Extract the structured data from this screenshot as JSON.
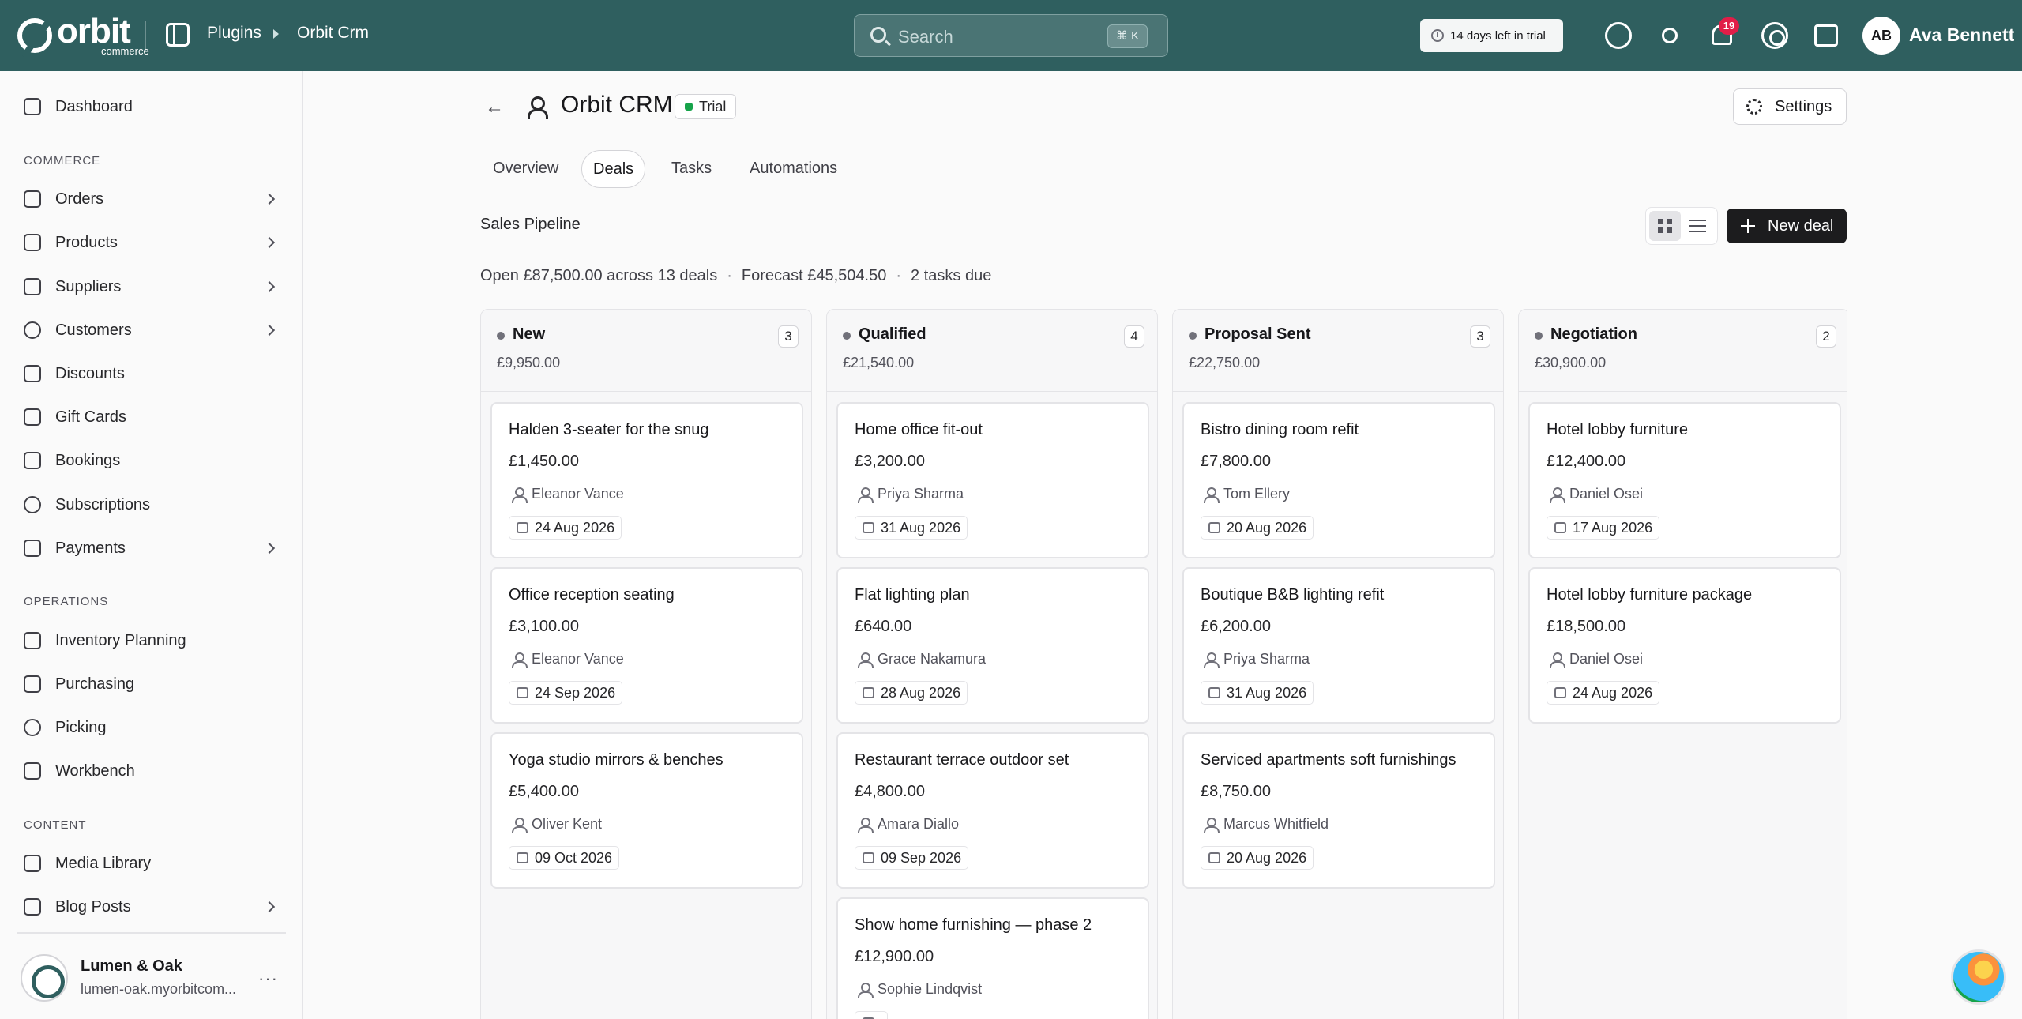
{
  "topbar": {
    "brand_name": "orbit",
    "brand_sub": "commerce",
    "breadcrumbs": [
      "Plugins",
      "Orbit Crm"
    ],
    "search_placeholder": "Search",
    "search_shortcut": "⌘ K",
    "trial_notice": "14 days left in trial",
    "notification_count": "19",
    "user_initials": "AB",
    "user_name": "Ava Bennett"
  },
  "sidebar": {
    "top_items": [
      {
        "label": "Dashboard",
        "icon": "dashboard-icon"
      }
    ],
    "sections": [
      {
        "title": "COMMERCE",
        "items": [
          {
            "label": "Orders",
            "icon": "orders-icon",
            "expandable": true
          },
          {
            "label": "Products",
            "icon": "products-icon",
            "expandable": true
          },
          {
            "label": "Suppliers",
            "icon": "suppliers-icon",
            "expandable": true
          },
          {
            "label": "Customers",
            "icon": "customers-icon",
            "expandable": true
          },
          {
            "label": "Discounts",
            "icon": "tag-icon",
            "expandable": false
          },
          {
            "label": "Gift Cards",
            "icon": "gift-icon",
            "expandable": false
          },
          {
            "label": "Bookings",
            "icon": "calendar-icon",
            "expandable": false
          },
          {
            "label": "Subscriptions",
            "icon": "refresh-icon",
            "expandable": false
          },
          {
            "label": "Payments",
            "icon": "card-icon",
            "expandable": true
          }
        ]
      },
      {
        "title": "OPERATIONS",
        "items": [
          {
            "label": "Inventory Planning",
            "icon": "clipboard-icon",
            "expandable": false
          },
          {
            "label": "Purchasing",
            "icon": "box-icon",
            "expandable": false
          },
          {
            "label": "Picking",
            "icon": "pin-icon",
            "expandable": false
          },
          {
            "label": "Workbench",
            "icon": "cube-icon",
            "expandable": false
          }
        ]
      },
      {
        "title": "CONTENT",
        "items": [
          {
            "label": "Media Library",
            "icon": "image-icon",
            "expandable": false
          },
          {
            "label": "Blog Posts",
            "icon": "blog-icon",
            "expandable": true
          }
        ]
      }
    ],
    "store": {
      "name": "Lumen & Oak",
      "url": "lumen-oak.myorbitcom...",
      "more": "···"
    }
  },
  "page": {
    "title": "Orbit CRM",
    "badge": "Trial",
    "settings_label": "Settings",
    "tabs": [
      "Overview",
      "Deals",
      "Tasks",
      "Automations"
    ],
    "active_tab": "Deals",
    "section_title": "Sales Pipeline",
    "new_deal_label": "New deal",
    "summary": {
      "open": "Open £87,500.00 across 13 deals",
      "forecast": "Forecast £45,504.50",
      "tasks": "2 tasks due",
      "separator": "·"
    }
  },
  "columns": [
    {
      "name": "New",
      "total": "£9,950.00",
      "count": "3",
      "deals": [
        {
          "title": "Halden 3-seater for the snug",
          "amount": "£1,450.00",
          "owner": "Eleanor Vance",
          "date": "24 Aug 2026"
        },
        {
          "title": "Office reception seating",
          "amount": "£3,100.00",
          "owner": "Eleanor Vance",
          "date": "24 Sep 2026"
        },
        {
          "title": "Yoga studio mirrors & benches",
          "amount": "£5,400.00",
          "owner": "Oliver Kent",
          "date": "09 Oct 2026"
        }
      ]
    },
    {
      "name": "Qualified",
      "total": "£21,540.00",
      "count": "4",
      "deals": [
        {
          "title": "Home office fit-out",
          "amount": "£3,200.00",
          "owner": "Priya Sharma",
          "date": "31 Aug 2026"
        },
        {
          "title": "Flat lighting plan",
          "amount": "£640.00",
          "owner": "Grace Nakamura",
          "date": "28 Aug 2026"
        },
        {
          "title": "Restaurant terrace outdoor set",
          "amount": "£4,800.00",
          "owner": "Amara Diallo",
          "date": "09 Sep 2026"
        },
        {
          "title": "Show home furnishing — phase 2",
          "amount": "£12,900.00",
          "owner": "Sophie Lindqvist",
          "date": ""
        }
      ]
    },
    {
      "name": "Proposal Sent",
      "total": "£22,750.00",
      "count": "3",
      "deals": [
        {
          "title": "Bistro dining room refit",
          "amount": "£7,800.00",
          "owner": "Tom Ellery",
          "date": "20 Aug 2026"
        },
        {
          "title": "Boutique B&B lighting refit",
          "amount": "£6,200.00",
          "owner": "Priya Sharma",
          "date": "31 Aug 2026"
        },
        {
          "title": "Serviced apartments soft furnishings",
          "amount": "£8,750.00",
          "owner": "Marcus Whitfield",
          "date": "20 Aug 2026"
        }
      ]
    },
    {
      "name": "Negotiation",
      "total": "£30,900.00",
      "count": "2",
      "deals": [
        {
          "title": "Hotel lobby furniture",
          "amount": "£12,400.00",
          "owner": "Daniel Osei",
          "date": "17 Aug 2026"
        },
        {
          "title": "Hotel lobby furniture package",
          "amount": "£18,500.00",
          "owner": "Daniel Osei",
          "date": "24 Aug 2026"
        }
      ]
    }
  ]
}
